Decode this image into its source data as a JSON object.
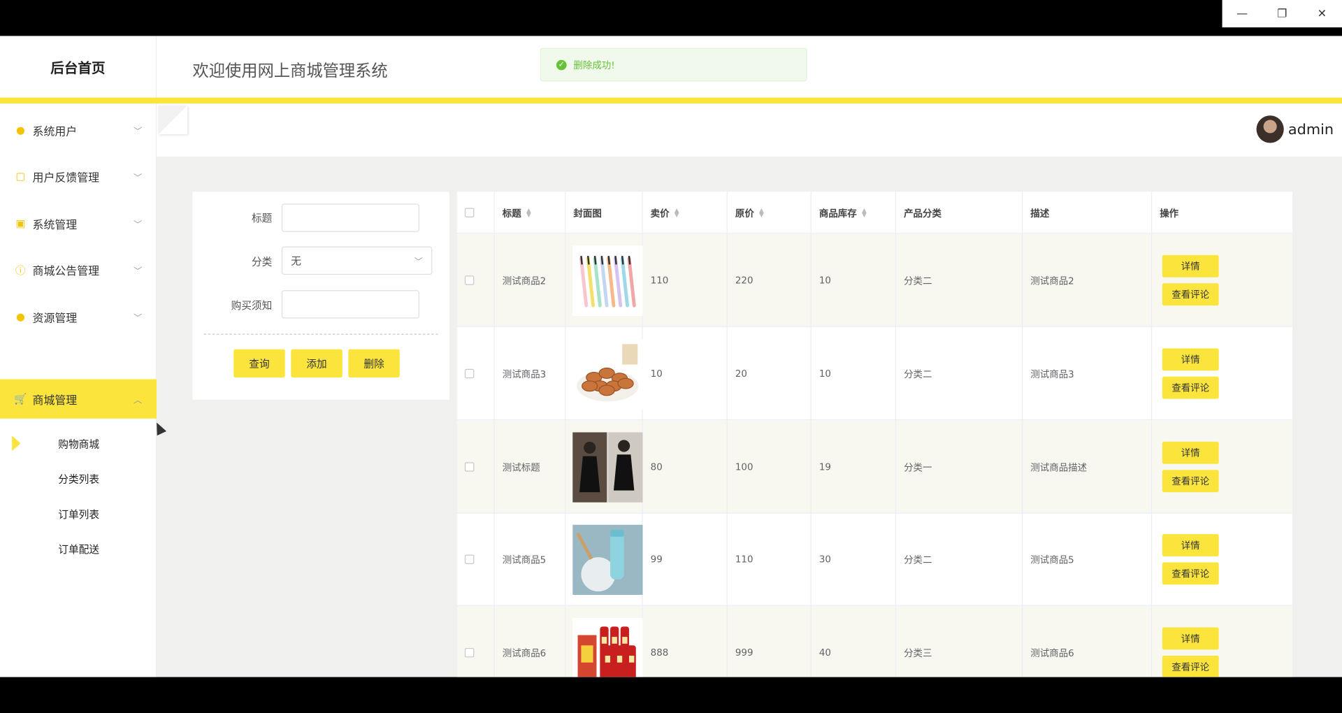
{
  "window_controls": {
    "minimize": "—",
    "restore": "❐",
    "close": "✕"
  },
  "header": {
    "logo": "后台首页",
    "welcome": "欢迎使用网上商城管理系统"
  },
  "toast": {
    "message": "删除成功!",
    "icon": "check-circle-icon"
  },
  "user": {
    "name": "admin"
  },
  "sidebar": {
    "items": [
      {
        "label": "系统用户",
        "icon": "user-icon"
      },
      {
        "label": "用户反馈管理",
        "icon": "feedback-icon"
      },
      {
        "label": "系统管理",
        "icon": "image-icon"
      },
      {
        "label": "商城公告管理",
        "icon": "info-icon"
      },
      {
        "label": "资源管理",
        "icon": "pin-icon"
      },
      {
        "label": "商城管理",
        "icon": "cart-icon",
        "active": true
      }
    ],
    "sub_items": [
      {
        "label": "购物商城",
        "active": true
      },
      {
        "label": "分类列表"
      },
      {
        "label": "订单列表"
      },
      {
        "label": "订单配送"
      }
    ]
  },
  "search": {
    "title_label": "标题",
    "title_value": "",
    "category_label": "分类",
    "category_value": "无",
    "notice_label": "购买须知",
    "notice_value": "",
    "query_button": "查询",
    "add_button": "添加",
    "delete_button": "删除"
  },
  "table": {
    "columns": [
      "标题",
      "封面图",
      "卖价",
      "原价",
      "商品库存",
      "产品分类",
      "描述",
      "操作"
    ],
    "rows": [
      {
        "title": "测试商品2",
        "cover": "toothbrushes",
        "price": "110",
        "original": "220",
        "stock": "10",
        "category": "分类二",
        "desc": "测试商品2"
      },
      {
        "title": "测试商品3",
        "cover": "almonds",
        "price": "10",
        "original": "20",
        "stock": "10",
        "category": "分类二",
        "desc": "测试商品3"
      },
      {
        "title": "测试标题",
        "cover": "black-dress",
        "price": "80",
        "original": "100",
        "stock": "19",
        "category": "分类一",
        "desc": "测试商品描述"
      },
      {
        "title": "测试商品5",
        "cover": "water-bottle",
        "price": "99",
        "original": "110",
        "stock": "30",
        "category": "分类二",
        "desc": "测试商品5"
      },
      {
        "title": "测试商品6",
        "cover": "liquor-bottles",
        "price": "888",
        "original": "999",
        "stock": "40",
        "category": "分类三",
        "desc": "测试商品6"
      }
    ],
    "detail_button": "详情",
    "comment_button": "查看评论"
  },
  "colors": {
    "accent": "#fbe53c",
    "success": "#67c23a"
  }
}
